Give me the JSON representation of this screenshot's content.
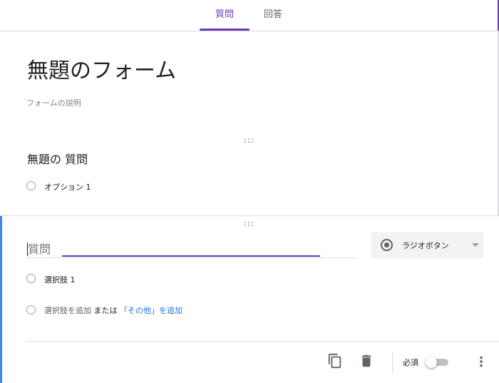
{
  "tabs": {
    "questions": "質問",
    "responses": "回答"
  },
  "form": {
    "title": "無題のフォーム",
    "description_placeholder": "フォームの説明"
  },
  "question1": {
    "title": "無題の 質問",
    "option1": "オプション 1"
  },
  "question2": {
    "placeholder": "質問",
    "type_label": "ラジオボタン",
    "option1": "選択肢 1",
    "add_option": "選択肢を追加",
    "or": "または",
    "add_other": "「その他」を追加"
  },
  "footer": {
    "required_label": "必須",
    "required": false
  },
  "icons": {
    "duplicate": "copy-icon",
    "delete": "trash-icon",
    "more": "more-vert-icon",
    "drag": "drag-handle-icon",
    "type": "radio-button-icon",
    "caret": "dropdown-caret-icon"
  },
  "colors": {
    "accent": "#673ab7",
    "link": "#1a73e8",
    "active_bar": "#4285f4"
  }
}
